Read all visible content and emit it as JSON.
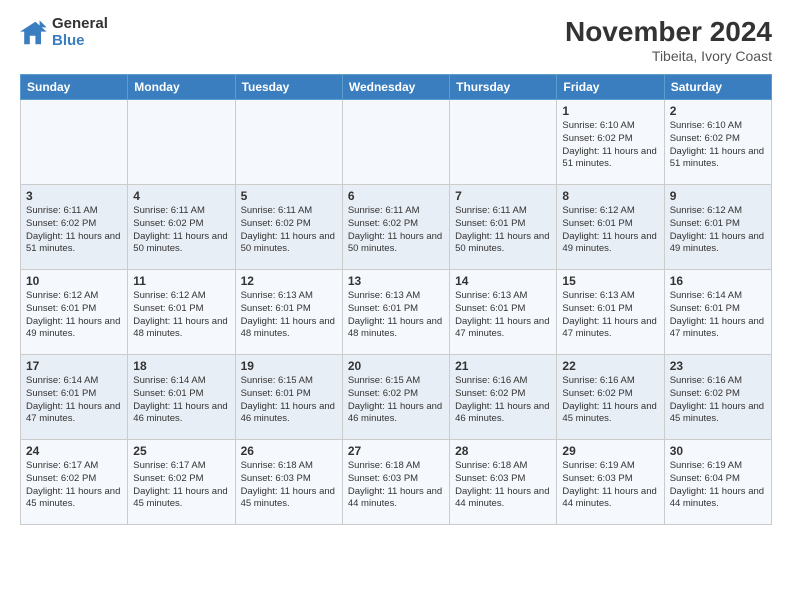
{
  "header": {
    "logo_line1": "General",
    "logo_line2": "Blue",
    "month_title": "November 2024",
    "location": "Tibeita, Ivory Coast"
  },
  "days_of_week": [
    "Sunday",
    "Monday",
    "Tuesday",
    "Wednesday",
    "Thursday",
    "Friday",
    "Saturday"
  ],
  "weeks": [
    [
      {
        "day": "",
        "text": ""
      },
      {
        "day": "",
        "text": ""
      },
      {
        "day": "",
        "text": ""
      },
      {
        "day": "",
        "text": ""
      },
      {
        "day": "",
        "text": ""
      },
      {
        "day": "1",
        "text": "Sunrise: 6:10 AM\nSunset: 6:02 PM\nDaylight: 11 hours and 51 minutes."
      },
      {
        "day": "2",
        "text": "Sunrise: 6:10 AM\nSunset: 6:02 PM\nDaylight: 11 hours and 51 minutes."
      }
    ],
    [
      {
        "day": "3",
        "text": "Sunrise: 6:11 AM\nSunset: 6:02 PM\nDaylight: 11 hours and 51 minutes."
      },
      {
        "day": "4",
        "text": "Sunrise: 6:11 AM\nSunset: 6:02 PM\nDaylight: 11 hours and 50 minutes."
      },
      {
        "day": "5",
        "text": "Sunrise: 6:11 AM\nSunset: 6:02 PM\nDaylight: 11 hours and 50 minutes."
      },
      {
        "day": "6",
        "text": "Sunrise: 6:11 AM\nSunset: 6:02 PM\nDaylight: 11 hours and 50 minutes."
      },
      {
        "day": "7",
        "text": "Sunrise: 6:11 AM\nSunset: 6:01 PM\nDaylight: 11 hours and 50 minutes."
      },
      {
        "day": "8",
        "text": "Sunrise: 6:12 AM\nSunset: 6:01 PM\nDaylight: 11 hours and 49 minutes."
      },
      {
        "day": "9",
        "text": "Sunrise: 6:12 AM\nSunset: 6:01 PM\nDaylight: 11 hours and 49 minutes."
      }
    ],
    [
      {
        "day": "10",
        "text": "Sunrise: 6:12 AM\nSunset: 6:01 PM\nDaylight: 11 hours and 49 minutes."
      },
      {
        "day": "11",
        "text": "Sunrise: 6:12 AM\nSunset: 6:01 PM\nDaylight: 11 hours and 48 minutes."
      },
      {
        "day": "12",
        "text": "Sunrise: 6:13 AM\nSunset: 6:01 PM\nDaylight: 11 hours and 48 minutes."
      },
      {
        "day": "13",
        "text": "Sunrise: 6:13 AM\nSunset: 6:01 PM\nDaylight: 11 hours and 48 minutes."
      },
      {
        "day": "14",
        "text": "Sunrise: 6:13 AM\nSunset: 6:01 PM\nDaylight: 11 hours and 47 minutes."
      },
      {
        "day": "15",
        "text": "Sunrise: 6:13 AM\nSunset: 6:01 PM\nDaylight: 11 hours and 47 minutes."
      },
      {
        "day": "16",
        "text": "Sunrise: 6:14 AM\nSunset: 6:01 PM\nDaylight: 11 hours and 47 minutes."
      }
    ],
    [
      {
        "day": "17",
        "text": "Sunrise: 6:14 AM\nSunset: 6:01 PM\nDaylight: 11 hours and 47 minutes."
      },
      {
        "day": "18",
        "text": "Sunrise: 6:14 AM\nSunset: 6:01 PM\nDaylight: 11 hours and 46 minutes."
      },
      {
        "day": "19",
        "text": "Sunrise: 6:15 AM\nSunset: 6:01 PM\nDaylight: 11 hours and 46 minutes."
      },
      {
        "day": "20",
        "text": "Sunrise: 6:15 AM\nSunset: 6:02 PM\nDaylight: 11 hours and 46 minutes."
      },
      {
        "day": "21",
        "text": "Sunrise: 6:16 AM\nSunset: 6:02 PM\nDaylight: 11 hours and 46 minutes."
      },
      {
        "day": "22",
        "text": "Sunrise: 6:16 AM\nSunset: 6:02 PM\nDaylight: 11 hours and 45 minutes."
      },
      {
        "day": "23",
        "text": "Sunrise: 6:16 AM\nSunset: 6:02 PM\nDaylight: 11 hours and 45 minutes."
      }
    ],
    [
      {
        "day": "24",
        "text": "Sunrise: 6:17 AM\nSunset: 6:02 PM\nDaylight: 11 hours and 45 minutes."
      },
      {
        "day": "25",
        "text": "Sunrise: 6:17 AM\nSunset: 6:02 PM\nDaylight: 11 hours and 45 minutes."
      },
      {
        "day": "26",
        "text": "Sunrise: 6:18 AM\nSunset: 6:03 PM\nDaylight: 11 hours and 45 minutes."
      },
      {
        "day": "27",
        "text": "Sunrise: 6:18 AM\nSunset: 6:03 PM\nDaylight: 11 hours and 44 minutes."
      },
      {
        "day": "28",
        "text": "Sunrise: 6:18 AM\nSunset: 6:03 PM\nDaylight: 11 hours and 44 minutes."
      },
      {
        "day": "29",
        "text": "Sunrise: 6:19 AM\nSunset: 6:03 PM\nDaylight: 11 hours and 44 minutes."
      },
      {
        "day": "30",
        "text": "Sunrise: 6:19 AM\nSunset: 6:04 PM\nDaylight: 11 hours and 44 minutes."
      }
    ]
  ]
}
